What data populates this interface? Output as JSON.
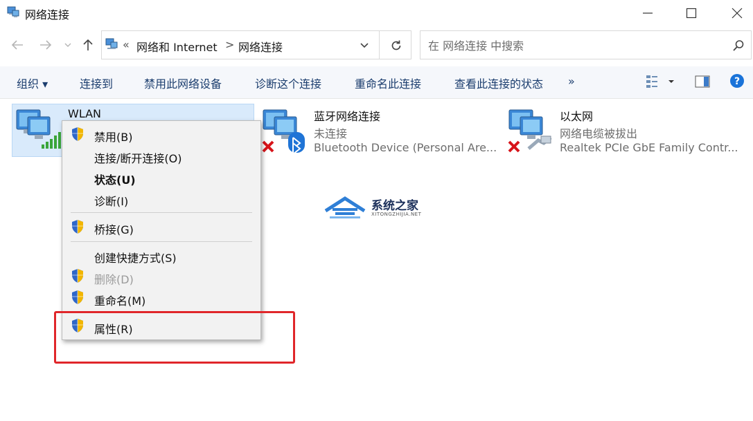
{
  "window": {
    "title": "网络连接"
  },
  "address": {
    "crumb_separator": "«",
    "crumbs": [
      "网络和 Internet",
      "网络连接"
    ],
    "arrow": ">"
  },
  "search": {
    "placeholder": "在 网络连接 中搜索"
  },
  "toolbar": {
    "organize": "组织 ▾",
    "connect_to": "连接到",
    "disable": "禁用此网络设备",
    "diagnose": "诊断这个连接",
    "rename": "重命名此连接",
    "view_status": "查看此连接的状态",
    "more": "»"
  },
  "connections": [
    {
      "name": "WLAN",
      "status": "",
      "device": ""
    },
    {
      "name": "蓝牙网络连接",
      "status": "未连接",
      "device": "Bluetooth Device (Personal Are..."
    },
    {
      "name": "以太网",
      "status": "网络电缆被拔出",
      "device": "Realtek PCIe GbE Family Contr..."
    }
  ],
  "context_menu": {
    "items": [
      {
        "label": "禁用(B)"
      },
      {
        "label": "连接/断开连接(O)"
      },
      {
        "label": "状态(U)"
      },
      {
        "label": "诊断(I)"
      },
      {
        "label": "桥接(G)"
      },
      {
        "label": "创建快捷方式(S)"
      },
      {
        "label": "删除(D)"
      },
      {
        "label": "重命名(M)"
      },
      {
        "label": "属性(R)"
      }
    ]
  },
  "watermark": {
    "name": "系统之家",
    "domain": "XITONGZHIJIA.NET"
  },
  "colors": {
    "accent": "#1b3d6e",
    "selection": "#d9eafb",
    "highlight": "#e0262a",
    "help": "#1a73d9"
  }
}
